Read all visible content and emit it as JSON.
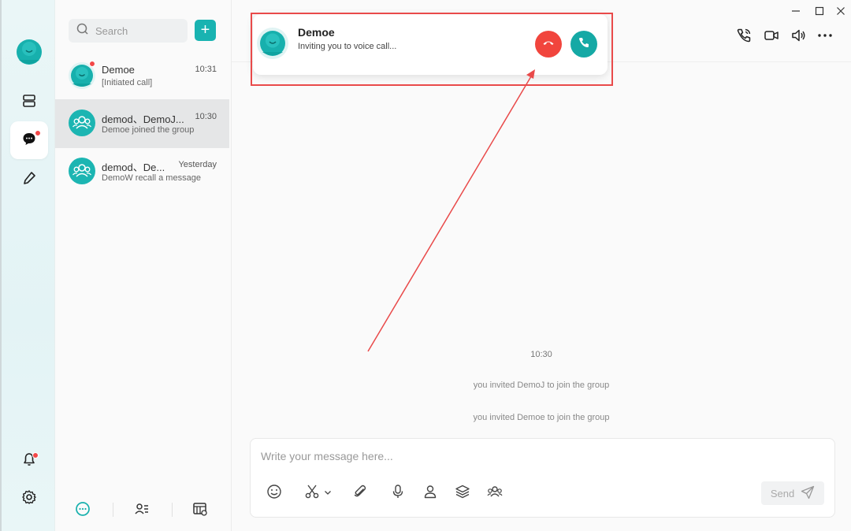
{
  "search": {
    "placeholder": "Search"
  },
  "conversations": [
    {
      "name": "Demoe",
      "time": "10:31",
      "subtitle": "[Initiated call]",
      "unread": true,
      "kind": "user"
    },
    {
      "name": "demod、DemoJ...",
      "time": "10:30",
      "subtitle": "Demoe joined the group",
      "unread": false,
      "kind": "group"
    },
    {
      "name": "demod、De...",
      "time": "Yesterday",
      "subtitle": "DemoW recall a message",
      "unread": false,
      "kind": "group"
    }
  ],
  "chat": {
    "timestamp": "10:30",
    "system_messages": [
      "you invited DemoJ to join the group",
      "you invited Demoe to join the group"
    ]
  },
  "composer": {
    "placeholder": "Write your message here...",
    "send_label": "Send"
  },
  "call": {
    "caller": "Demoe",
    "message": "Inviting you to voice call..."
  },
  "colors": {
    "accent": "#19b3b1",
    "decline": "#f1453d",
    "unread": "#f24848",
    "annotation": "#e94a4a"
  }
}
